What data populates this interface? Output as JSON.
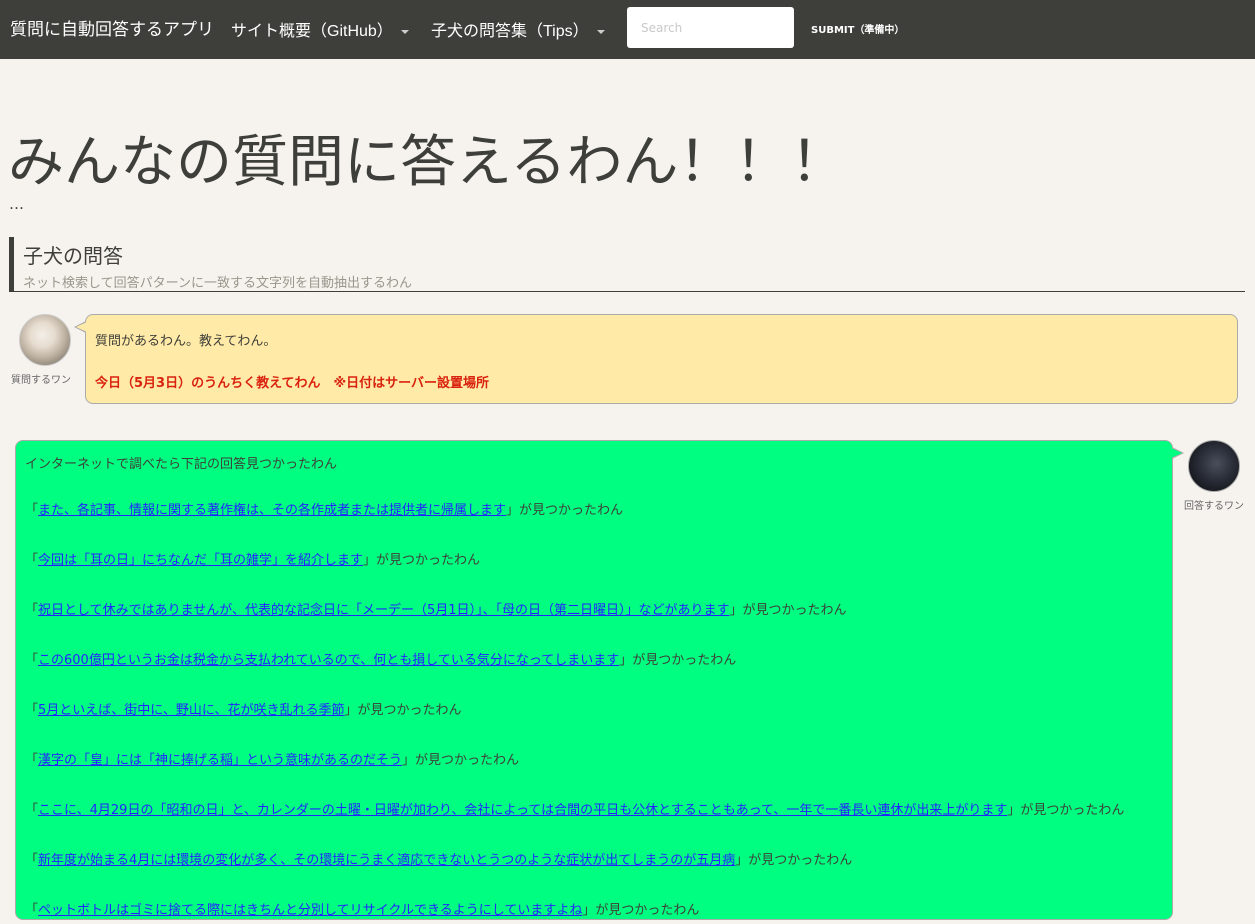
{
  "navbar": {
    "brand": "質問に自動回答するアプリ",
    "menu": [
      {
        "label": "サイト概要（GitHub）"
      },
      {
        "label": "子犬の問答集（Tips）"
      }
    ],
    "search_placeholder": "Search",
    "submit_label": "SUBMIT（準備中）"
  },
  "main": {
    "title": "みんなの質問に答えるわん！！！",
    "ellipsis": "…",
    "section": {
      "title": "子犬の問答",
      "subtitle": "ネット検索して回答パターンに一致する文字列を自動抽出するわん"
    }
  },
  "question": {
    "avatar_label": "質問するワン",
    "line1": "質問があるわん。教えてわん。",
    "line2": "今日（5月3日）のうんちく教えてわん　※日付はサーバー設置場所"
  },
  "answer": {
    "avatar_label": "回答するワン",
    "intro": "インターネットで調べたら下記の回答見つかったわん",
    "open_quote": "「",
    "suffix": "」が見つかったわん",
    "items": [
      {
        "text": "また、各記事、情報に関する著作権は、その各作成者または提供者に帰属します"
      },
      {
        "text": "今回は「耳の日」にちなんだ「耳の雑学」を紹介します"
      },
      {
        "text": "祝日として休みではありませんが、代表的な記念日に「メーデー（5月1日）」、「母の日（第二日曜日）」などがあります"
      },
      {
        "text": "この600億円というお金は税金から支払われているので、何とも損している気分になってしまいます"
      },
      {
        "text": "5月といえば、街中に、野山に、花が咲き乱れる季節"
      },
      {
        "text": "漢字の「皇」には「神に捧げる稲」という意味があるのだそう"
      },
      {
        "text": "ここに、4月29日の「昭和の日」と、カレンダーの土曜・日曜が加わり、会社によっては合間の平日も公休とすることもあって、一年で一番長い連休が出来上がります"
      },
      {
        "text": "新年度が始まる4月には環境の変化が多く、その環境にうまく適応できないとうつのような症状が出てしまうのが五月病"
      },
      {
        "text": "ペットボトルはゴミに捨てる際にはきちんと分別してリサイクルできるようにしていますよね"
      }
    ]
  },
  "colors": {
    "navbar_bg": "#3e3f3a",
    "page_bg": "#f6f3ef",
    "question_bubble": "#ffeaa7",
    "answer_bubble": "#00ff80",
    "alert_red": "#d9230f",
    "link_blue": "#2323ff"
  }
}
